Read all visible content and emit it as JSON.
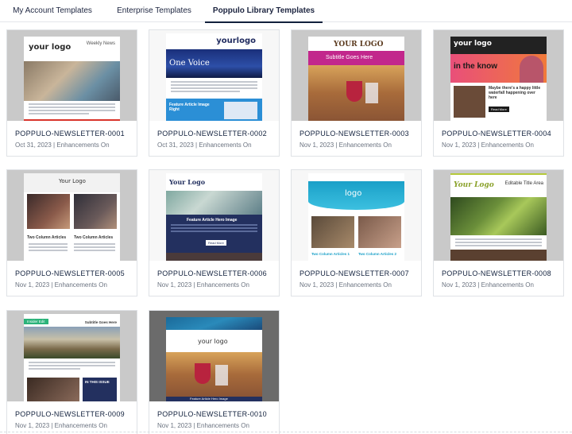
{
  "tabs": [
    {
      "label": "My Account Templates"
    },
    {
      "label": "Enterprise Templates"
    },
    {
      "label": "Poppulo Library Templates"
    }
  ],
  "templates": [
    {
      "name": "POPPULO-NEWSLETTER-0001",
      "meta": "Oct 31, 2023 | Enhancements On"
    },
    {
      "name": "POPPULO-NEWSLETTER-0002",
      "meta": "Oct 31, 2023 | Enhancements On"
    },
    {
      "name": "POPPULO-NEWSLETTER-0003",
      "meta": "Nov 1, 2023 | Enhancements On"
    },
    {
      "name": "POPPULO-NEWSLETTER-0004",
      "meta": "Nov 1, 2023 | Enhancements On"
    },
    {
      "name": "POPPULO-NEWSLETTER-0005",
      "meta": "Nov 1, 2023 | Enhancements On"
    },
    {
      "name": "POPPULO-NEWSLETTER-0006",
      "meta": "Nov 1, 2023 | Enhancements On"
    },
    {
      "name": "POPPULO-NEWSLETTER-0007",
      "meta": "Nov 1, 2023 | Enhancements On"
    },
    {
      "name": "POPPULO-NEWSLETTER-0008",
      "meta": "Nov 1, 2023 | Enhancements On"
    },
    {
      "name": "POPPULO-NEWSLETTER-0009",
      "meta": "Nov 1, 2023 | Enhancements On"
    },
    {
      "name": "POPPULO-NEWSLETTER-0010",
      "meta": "Nov 1, 2023 | Enhancements On"
    }
  ],
  "thumbs": {
    "t1": {
      "logo": "your logo",
      "header": "Weekly News"
    },
    "t2": {
      "logo": "yourlogo",
      "banner": "One Voice",
      "article": "Feature Article Image Right"
    },
    "t3": {
      "logo": "YOUR LOGO",
      "banner": "Subtitle Goes Here"
    },
    "t4": {
      "logo": "your logo",
      "banner": "in the know",
      "teaser": "Maybe there's a happy little waterfall happening over here",
      "cta": "Read More"
    },
    "t5": {
      "logo": "Your Logo",
      "col1": "Two Column Articles",
      "col2": "Two Column Articles"
    },
    "t6": {
      "logo": "Your Logo",
      "article": "Feature Article Hero Image",
      "cta": "Read More"
    },
    "t7": {
      "logo": "logo",
      "col1": "Two Column Articles 1",
      "col2": "Two Column Articles 2"
    },
    "t8": {
      "logo": "Your Logo",
      "title": "Editable Title Area"
    },
    "t9": {
      "badge": "Insider Edit",
      "subtitle": "Subtitle Goes Here",
      "sidebar": "IN THIS ISSUE"
    },
    "t10": {
      "logo": "your logo",
      "article": "Feature Article Hero Image"
    }
  },
  "colors": {
    "accent": "#12213d",
    "magenta": "#c2278c",
    "navy": "#23305f",
    "teal": "#1aa0c8"
  }
}
